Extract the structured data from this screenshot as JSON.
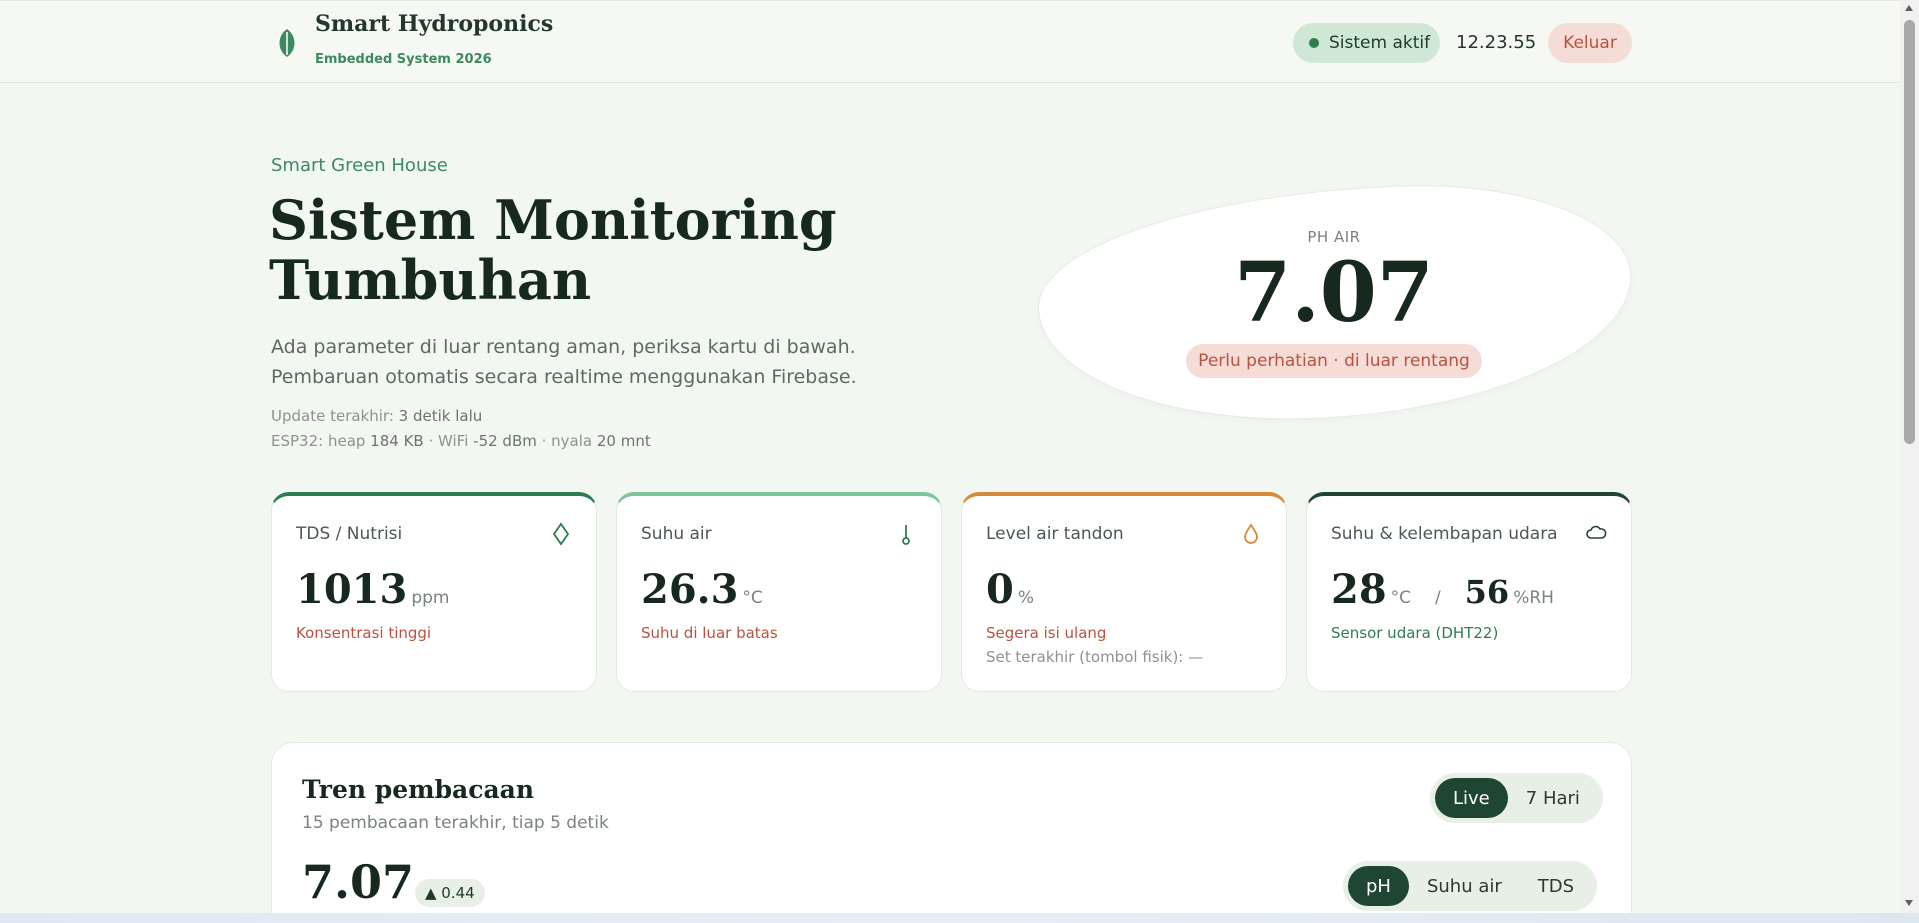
{
  "header": {
    "brand_title": "Smart Hydroponics",
    "brand_subtitle": "Embedded System 2026",
    "status_label": "Sistem aktif",
    "clock": "12.23.55",
    "logout_label": "Keluar",
    "brand_icon": "leaf-icon"
  },
  "hero": {
    "eyebrow": "Smart Green House",
    "title": "Sistem Monitoring Tumbuhan",
    "description": "Ada parameter di luar rentang aman, periksa kartu di bawah. Pembaruan otomatis secara realtime menggunakan Firebase.",
    "update_label": "Update terakhir: ",
    "update_value": "3 detik lalu",
    "esp_prefix": "ESP32: heap ",
    "esp_heap": "184 KB",
    "esp_wifi_prefix": " · WiFi ",
    "esp_wifi": "-52 dBm",
    "esp_uptime_prefix": " · nyala ",
    "esp_uptime": "20 mnt"
  },
  "ph": {
    "label": "PH AIR",
    "value": "7.07",
    "status": "Perlu perhatian · di luar rentang"
  },
  "cards": [
    {
      "title": "TDS / Nutrisi",
      "icon": "diamond-icon",
      "value": "1013",
      "unit": "ppm",
      "status": "Konsentrasi tinggi",
      "status_color": "#b9523f",
      "accent": "#2e7d52",
      "note": ""
    },
    {
      "title": "Suhu air",
      "icon": "thermometer-icon",
      "value": "26.3",
      "unit": "°C",
      "status": "Suhu di luar batas",
      "status_color": "#b9523f",
      "accent": "#7cc79a",
      "note": ""
    },
    {
      "title": "Level air tandon",
      "icon": "water-drop-icon",
      "value": "0",
      "unit": "%",
      "status": "Segera isi ulang",
      "status_color": "#b9523f",
      "accent": "#d88a3c",
      "note": "Set terakhir (tombol fisik): —"
    },
    {
      "title": "Suhu & kelembapan udara",
      "icon": "cloud-icon",
      "value": "28",
      "unit": "°C",
      "separator": "/",
      "value2": "56",
      "unit2": "%RH",
      "status": "Sensor udara (DHT22)",
      "status_color": "#2e7d52",
      "accent": "#1f4633",
      "note": ""
    }
  ],
  "trend": {
    "title": "Tren pembacaan",
    "subtitle": "15 pembacaan terakhir, tiap 5 detik",
    "range_tabs": [
      "Live",
      "7 Hari"
    ],
    "range_active": "Live",
    "metric_tabs": [
      "pH",
      "Suhu air",
      "TDS"
    ],
    "metric_active": "pH",
    "current_value": "7.07",
    "delta": "▲ 0.44"
  }
}
